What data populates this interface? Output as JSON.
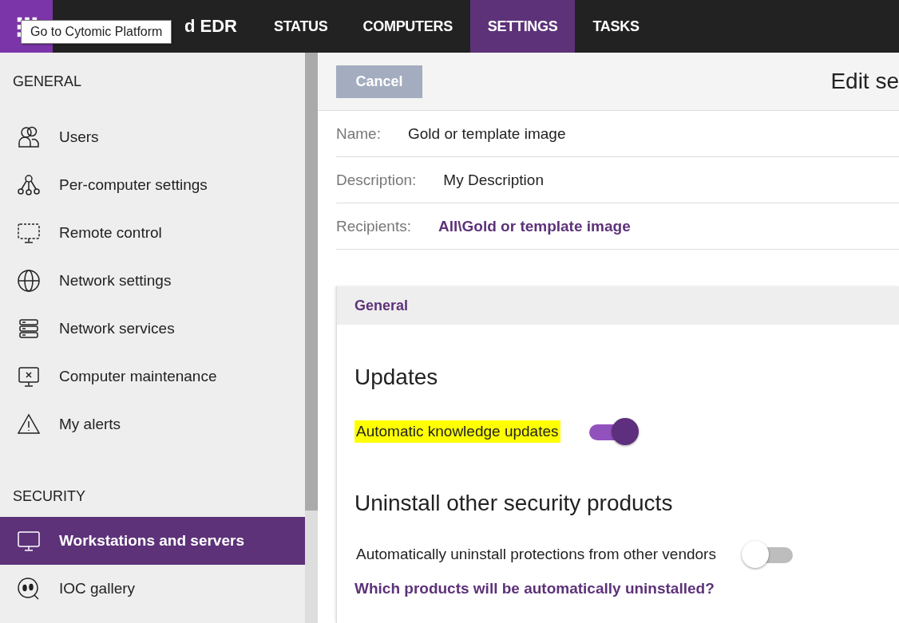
{
  "topbar": {
    "apps_tooltip": "Go to Cytomic Platform",
    "product_name": "d EDR",
    "tabs": [
      {
        "label": "STATUS",
        "selected": false
      },
      {
        "label": "COMPUTERS",
        "selected": false
      },
      {
        "label": "SETTINGS",
        "selected": true
      },
      {
        "label": "TASKS",
        "selected": false
      }
    ]
  },
  "sidebar": {
    "sections": [
      {
        "title": "GENERAL",
        "items": [
          {
            "label": "Users",
            "selected": false
          },
          {
            "label": "Per-computer settings",
            "selected": false
          },
          {
            "label": "Remote control",
            "selected": false
          },
          {
            "label": "Network settings",
            "selected": false
          },
          {
            "label": "Network services",
            "selected": false
          },
          {
            "label": "Computer maintenance",
            "selected": false
          },
          {
            "label": "My alerts",
            "selected": false
          }
        ]
      },
      {
        "title": "SECURITY",
        "items": [
          {
            "label": "Workstations and servers",
            "selected": true
          },
          {
            "label": "IOC gallery",
            "selected": false
          }
        ]
      }
    ]
  },
  "header": {
    "cancel_button": "Cancel",
    "title": "Edit se"
  },
  "fields": [
    {
      "label": "Name:",
      "value": "Gold or template image",
      "kind": "text"
    },
    {
      "label": "Description:",
      "value": "My Description",
      "kind": "text"
    },
    {
      "label": "Recipients:",
      "value": "All\\Gold or template image",
      "kind": "link"
    }
  ],
  "panel": {
    "tab": "General",
    "groups": [
      {
        "heading": "Updates",
        "settings": [
          {
            "label": "Automatic knowledge updates",
            "on": true,
            "highlighted": true
          }
        ]
      },
      {
        "heading": "Uninstall other security products",
        "settings": [
          {
            "label": "Automatically uninstall protections from other vendors",
            "on": false,
            "highlighted": false
          }
        ],
        "link": "Which products will be automatically uninstalled?"
      }
    ]
  }
}
